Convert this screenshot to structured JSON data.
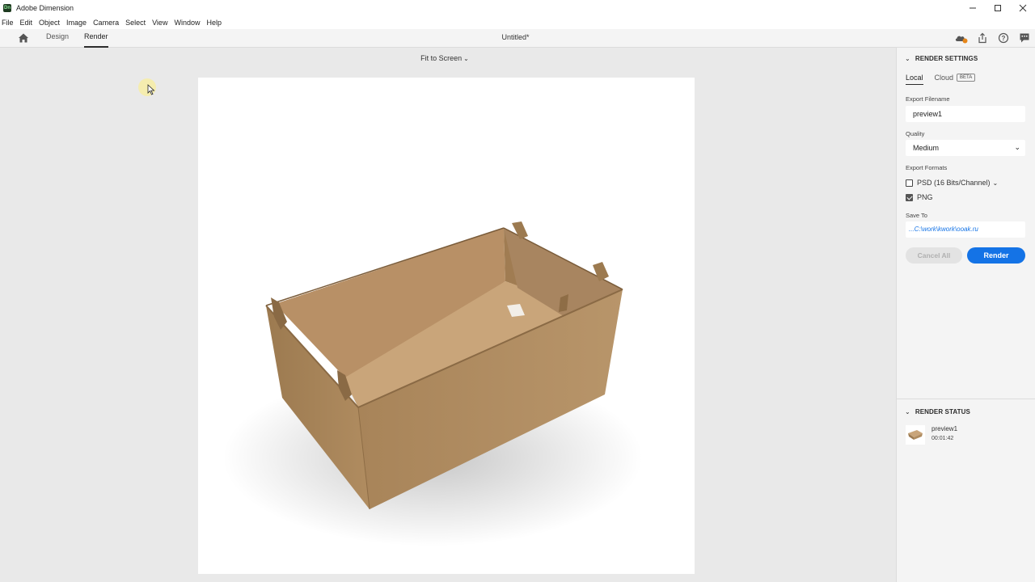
{
  "window": {
    "logo_text": "Dn",
    "app_title": "Adobe Dimension"
  },
  "menu": [
    "File",
    "Edit",
    "Object",
    "Image",
    "Camera",
    "Select",
    "View",
    "Window",
    "Help"
  ],
  "toolbar": {
    "tab_design": "Design",
    "tab_render": "Render",
    "active_tab": "Render",
    "document_title": "Untitled*"
  },
  "canvas": {
    "zoom_label": "Fit to Screen"
  },
  "render_settings": {
    "header": "RENDER SETTINGS",
    "tab_local": "Local",
    "tab_cloud": "Cloud",
    "beta_badge": "BETA",
    "export_filename_label": "Export Filename",
    "export_filename_value": "preview1",
    "quality_label": "Quality",
    "quality_value": "Medium",
    "export_formats_label": "Export Formats",
    "format_psd": "PSD (16 Bits/Channel)",
    "format_psd_checked": false,
    "format_png": "PNG",
    "format_png_checked": true,
    "save_to_label": "Save To",
    "save_to_value": "...C:\\work\\kwork\\ooak.ru",
    "cancel_all": "Cancel All",
    "render_button": "Render"
  },
  "render_status": {
    "header": "RENDER STATUS",
    "item_name": "preview1",
    "item_time": "00:01:42"
  },
  "colors": {
    "accent": "#1473e6",
    "cardboard": "#b48c5c"
  }
}
